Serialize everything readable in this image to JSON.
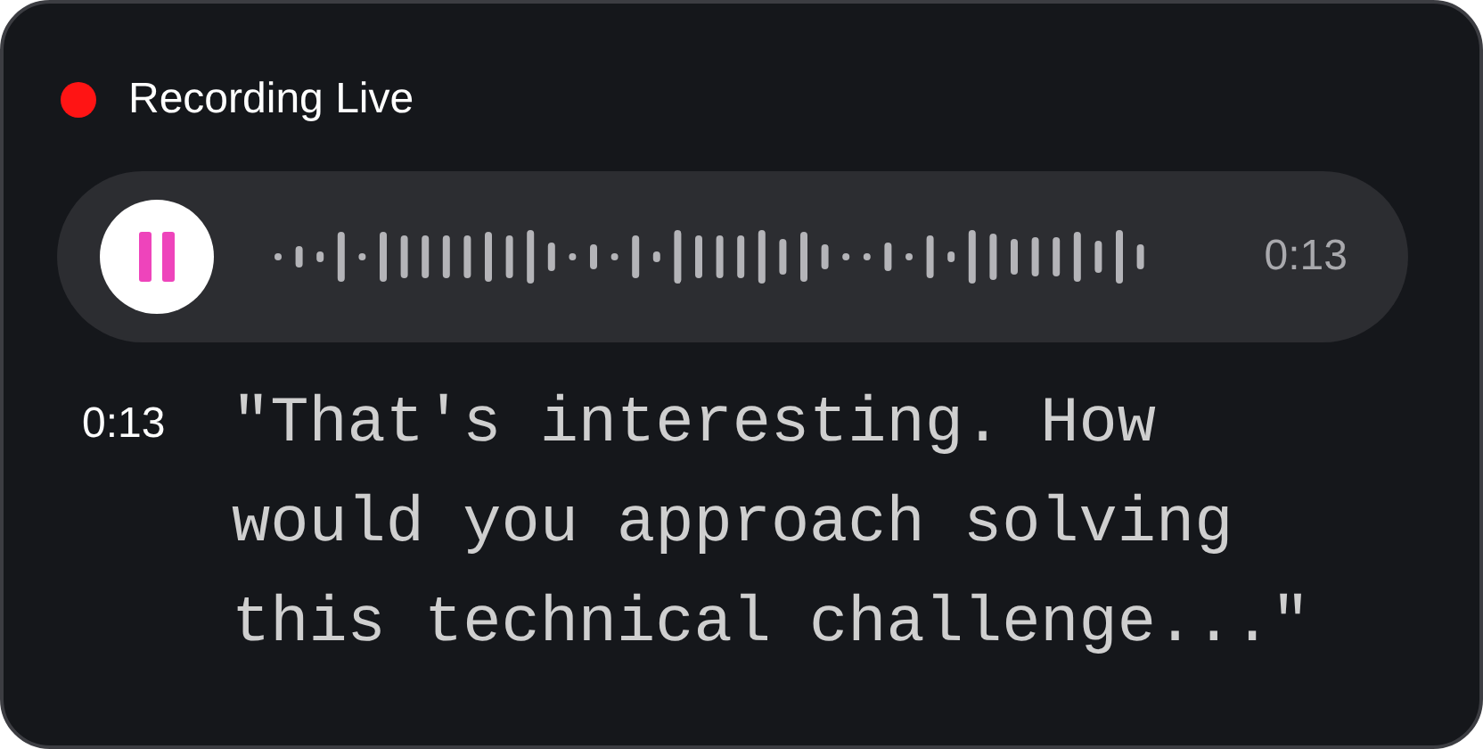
{
  "status": {
    "label": "Recording Live",
    "color": "#ff1414"
  },
  "player": {
    "playing": true,
    "time": "0:13"
  },
  "transcript": [
    {
      "time": "0:13",
      "text": "\"That's interesting. How would you approach solving this technical challenge...\""
    }
  ]
}
